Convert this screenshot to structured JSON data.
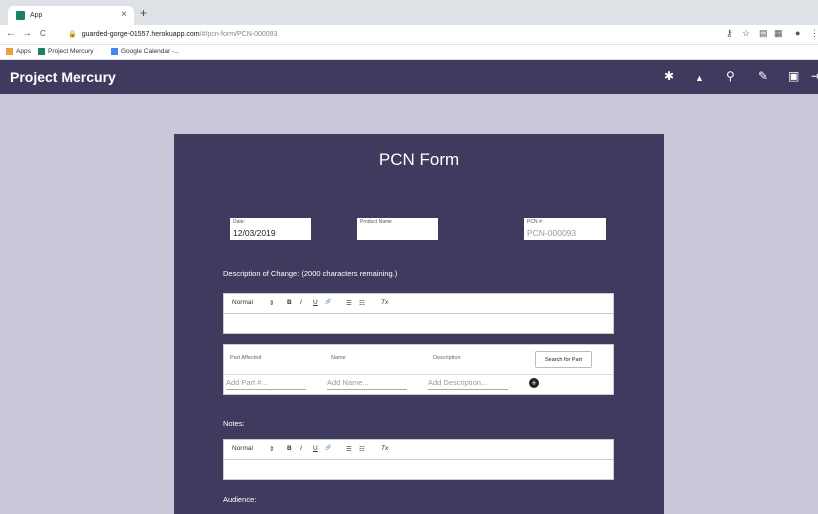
{
  "browser": {
    "tab_title": "App",
    "tab_close": "×",
    "new_tab": "+",
    "url_domain": "guarded-gorge-01557.herokuapp.com",
    "url_path": "/#/pcn-form/PCN-000093",
    "back": "←",
    "forward": "→",
    "reload": "C",
    "lock": "🔒",
    "bookmarks": [
      {
        "label": "Apps",
        "color": "#e8a33d"
      },
      {
        "label": "Project Mercury",
        "color": "#1b7f6a"
      },
      {
        "label": "Google Calendar -...",
        "color": "#4285f4"
      }
    ]
  },
  "app": {
    "title": "Project Mercury",
    "header_icons": [
      {
        "name": "settings-icon",
        "glyph": "✱"
      },
      {
        "name": "user-icon",
        "glyph": "▲"
      },
      {
        "name": "search-icon",
        "glyph": "⚲"
      },
      {
        "name": "wrench-icon",
        "glyph": "✎"
      },
      {
        "name": "feedback-icon",
        "glyph": "▣"
      }
    ]
  },
  "form": {
    "title": "PCN Form",
    "date_label": "Date:",
    "date_value": "12/03/2019",
    "product_label": "Product Name",
    "product_value": "",
    "pcn_label": "PCN #:",
    "pcn_value": "PCN-000093",
    "description_label": "Description of Change: (2000 characters remaining.)",
    "toolbar": {
      "normal": "Normal",
      "select_arrow": "⇕",
      "bold": "B",
      "italic": "I",
      "underline": "U",
      "link": "🔗",
      "ordered_list": "☰",
      "bullet_list": "☷",
      "clear": "Tx"
    },
    "parts": {
      "col_part": "Part Affected",
      "col_name": "Name",
      "col_description": "Description",
      "search_button": "Search for Part",
      "part_placeholder": "Add Part #...",
      "name_placeholder": "Add Name...",
      "description_placeholder": "Add Description...",
      "add_glyph": "+"
    },
    "notes_label": "Notes:",
    "audience_label": "Audience:"
  }
}
